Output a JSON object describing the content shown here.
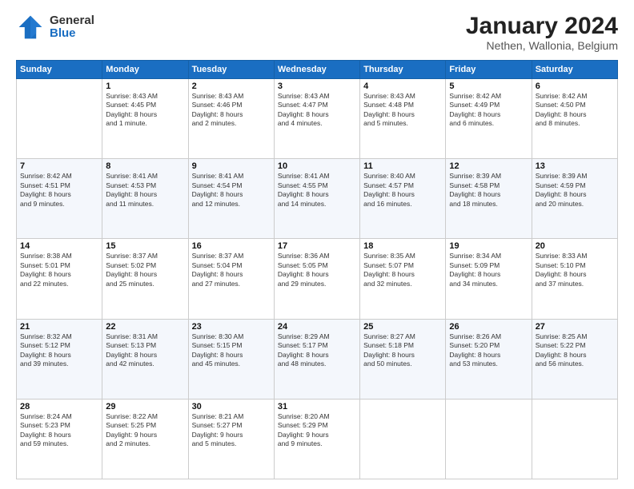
{
  "logo": {
    "general": "General",
    "blue": "Blue"
  },
  "title": "January 2024",
  "subtitle": "Nethen, Wallonia, Belgium",
  "headers": [
    "Sunday",
    "Monday",
    "Tuesday",
    "Wednesday",
    "Thursday",
    "Friday",
    "Saturday"
  ],
  "weeks": [
    [
      {
        "num": "",
        "info": ""
      },
      {
        "num": "1",
        "info": "Sunrise: 8:43 AM\nSunset: 4:45 PM\nDaylight: 8 hours\nand 1 minute."
      },
      {
        "num": "2",
        "info": "Sunrise: 8:43 AM\nSunset: 4:46 PM\nDaylight: 8 hours\nand 2 minutes."
      },
      {
        "num": "3",
        "info": "Sunrise: 8:43 AM\nSunset: 4:47 PM\nDaylight: 8 hours\nand 4 minutes."
      },
      {
        "num": "4",
        "info": "Sunrise: 8:43 AM\nSunset: 4:48 PM\nDaylight: 8 hours\nand 5 minutes."
      },
      {
        "num": "5",
        "info": "Sunrise: 8:42 AM\nSunset: 4:49 PM\nDaylight: 8 hours\nand 6 minutes."
      },
      {
        "num": "6",
        "info": "Sunrise: 8:42 AM\nSunset: 4:50 PM\nDaylight: 8 hours\nand 8 minutes."
      }
    ],
    [
      {
        "num": "7",
        "info": "Sunrise: 8:42 AM\nSunset: 4:51 PM\nDaylight: 8 hours\nand 9 minutes."
      },
      {
        "num": "8",
        "info": "Sunrise: 8:41 AM\nSunset: 4:53 PM\nDaylight: 8 hours\nand 11 minutes."
      },
      {
        "num": "9",
        "info": "Sunrise: 8:41 AM\nSunset: 4:54 PM\nDaylight: 8 hours\nand 12 minutes."
      },
      {
        "num": "10",
        "info": "Sunrise: 8:41 AM\nSunset: 4:55 PM\nDaylight: 8 hours\nand 14 minutes."
      },
      {
        "num": "11",
        "info": "Sunrise: 8:40 AM\nSunset: 4:57 PM\nDaylight: 8 hours\nand 16 minutes."
      },
      {
        "num": "12",
        "info": "Sunrise: 8:39 AM\nSunset: 4:58 PM\nDaylight: 8 hours\nand 18 minutes."
      },
      {
        "num": "13",
        "info": "Sunrise: 8:39 AM\nSunset: 4:59 PM\nDaylight: 8 hours\nand 20 minutes."
      }
    ],
    [
      {
        "num": "14",
        "info": "Sunrise: 8:38 AM\nSunset: 5:01 PM\nDaylight: 8 hours\nand 22 minutes."
      },
      {
        "num": "15",
        "info": "Sunrise: 8:37 AM\nSunset: 5:02 PM\nDaylight: 8 hours\nand 25 minutes."
      },
      {
        "num": "16",
        "info": "Sunrise: 8:37 AM\nSunset: 5:04 PM\nDaylight: 8 hours\nand 27 minutes."
      },
      {
        "num": "17",
        "info": "Sunrise: 8:36 AM\nSunset: 5:05 PM\nDaylight: 8 hours\nand 29 minutes."
      },
      {
        "num": "18",
        "info": "Sunrise: 8:35 AM\nSunset: 5:07 PM\nDaylight: 8 hours\nand 32 minutes."
      },
      {
        "num": "19",
        "info": "Sunrise: 8:34 AM\nSunset: 5:09 PM\nDaylight: 8 hours\nand 34 minutes."
      },
      {
        "num": "20",
        "info": "Sunrise: 8:33 AM\nSunset: 5:10 PM\nDaylight: 8 hours\nand 37 minutes."
      }
    ],
    [
      {
        "num": "21",
        "info": "Sunrise: 8:32 AM\nSunset: 5:12 PM\nDaylight: 8 hours\nand 39 minutes."
      },
      {
        "num": "22",
        "info": "Sunrise: 8:31 AM\nSunset: 5:13 PM\nDaylight: 8 hours\nand 42 minutes."
      },
      {
        "num": "23",
        "info": "Sunrise: 8:30 AM\nSunset: 5:15 PM\nDaylight: 8 hours\nand 45 minutes."
      },
      {
        "num": "24",
        "info": "Sunrise: 8:29 AM\nSunset: 5:17 PM\nDaylight: 8 hours\nand 48 minutes."
      },
      {
        "num": "25",
        "info": "Sunrise: 8:27 AM\nSunset: 5:18 PM\nDaylight: 8 hours\nand 50 minutes."
      },
      {
        "num": "26",
        "info": "Sunrise: 8:26 AM\nSunset: 5:20 PM\nDaylight: 8 hours\nand 53 minutes."
      },
      {
        "num": "27",
        "info": "Sunrise: 8:25 AM\nSunset: 5:22 PM\nDaylight: 8 hours\nand 56 minutes."
      }
    ],
    [
      {
        "num": "28",
        "info": "Sunrise: 8:24 AM\nSunset: 5:23 PM\nDaylight: 8 hours\nand 59 minutes."
      },
      {
        "num": "29",
        "info": "Sunrise: 8:22 AM\nSunset: 5:25 PM\nDaylight: 9 hours\nand 2 minutes."
      },
      {
        "num": "30",
        "info": "Sunrise: 8:21 AM\nSunset: 5:27 PM\nDaylight: 9 hours\nand 5 minutes."
      },
      {
        "num": "31",
        "info": "Sunrise: 8:20 AM\nSunset: 5:29 PM\nDaylight: 9 hours\nand 9 minutes."
      },
      {
        "num": "",
        "info": ""
      },
      {
        "num": "",
        "info": ""
      },
      {
        "num": "",
        "info": ""
      }
    ]
  ]
}
